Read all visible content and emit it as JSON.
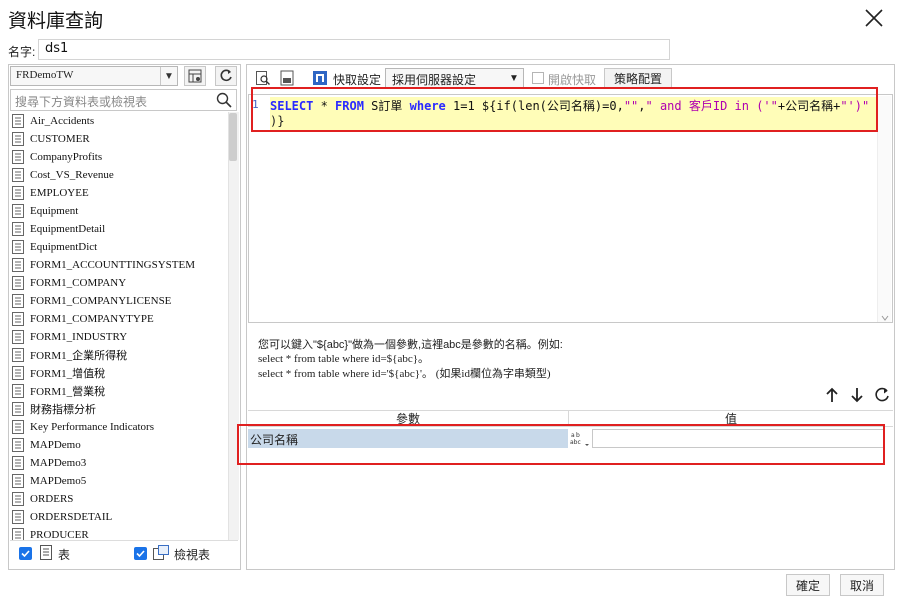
{
  "window": {
    "title": "資料庫查詢"
  },
  "name_row": {
    "label": "名字:",
    "value": "ds1"
  },
  "left": {
    "connection": "FRDemoTW",
    "search_placeholder": "搜尋下方資料表或檢視表",
    "tables": [
      "Air_Accidents",
      "CUSTOMER",
      "CompanyProfits",
      "Cost_VS_Revenue",
      "EMPLOYEE",
      "Equipment",
      "EquipmentDetail",
      "EquipmentDict",
      "FORM1_ACCOUNTTINGSYSTEM",
      "FORM1_COMPANY",
      "FORM1_COMPANYLICENSE",
      "FORM1_COMPANYTYPE",
      "FORM1_INDUSTRY",
      "FORM1_企業所得稅",
      "FORM1_增值稅",
      "FORM1_營業稅",
      "財務指標分析",
      "Key Performance Indicators",
      "MAPDemo",
      "MAPDemo3",
      "MAPDemo5",
      "ORDERS",
      "ORDERSDETAIL",
      "PRODUCER"
    ],
    "filter_table_label": "表",
    "filter_view_label": "檢視表"
  },
  "toolbar": {
    "preview_label": "快取設定",
    "server_setting": "採用伺服器設定",
    "enable_cache_label": "開啟快取",
    "strategy_button": "策略配置"
  },
  "editor": {
    "line_number": "1",
    "line1": {
      "t1": "SELECT",
      "t2": " * ",
      "t3": "FROM",
      "t4": " S訂單 ",
      "t5": "where",
      "t6": " 1=1 ${if(len(公司名稱)=0,",
      "t7": "\"\"",
      "t8": ",",
      "t9": "\" and 客戶ID in ('\"",
      "t10": "+公司名稱+",
      "t11": "\"')\""
    },
    "line2": ")}"
  },
  "help": {
    "line1": "您可以鍵入\"${abc}\"做為一個參數,這裡abc是參數的名稱。例如:",
    "line2": "select * from table where id=${abc}。",
    "line3": "select * from table where id='${abc}'。 (如果id欄位為字串類型)"
  },
  "params": {
    "col_param": "參數",
    "col_value": "值",
    "rows": [
      {
        "name": "公司名稱",
        "type_icon": "abc",
        "value": ""
      }
    ]
  },
  "footer": {
    "ok": "確定",
    "cancel": "取消"
  },
  "colors": {
    "highlight": "#fffdb8",
    "red_box": "#e02020",
    "keyword": "#2a2aff",
    "string": "#b000b0",
    "checkbox": "#1a73e8",
    "param_row": "#c8d9ea"
  }
}
